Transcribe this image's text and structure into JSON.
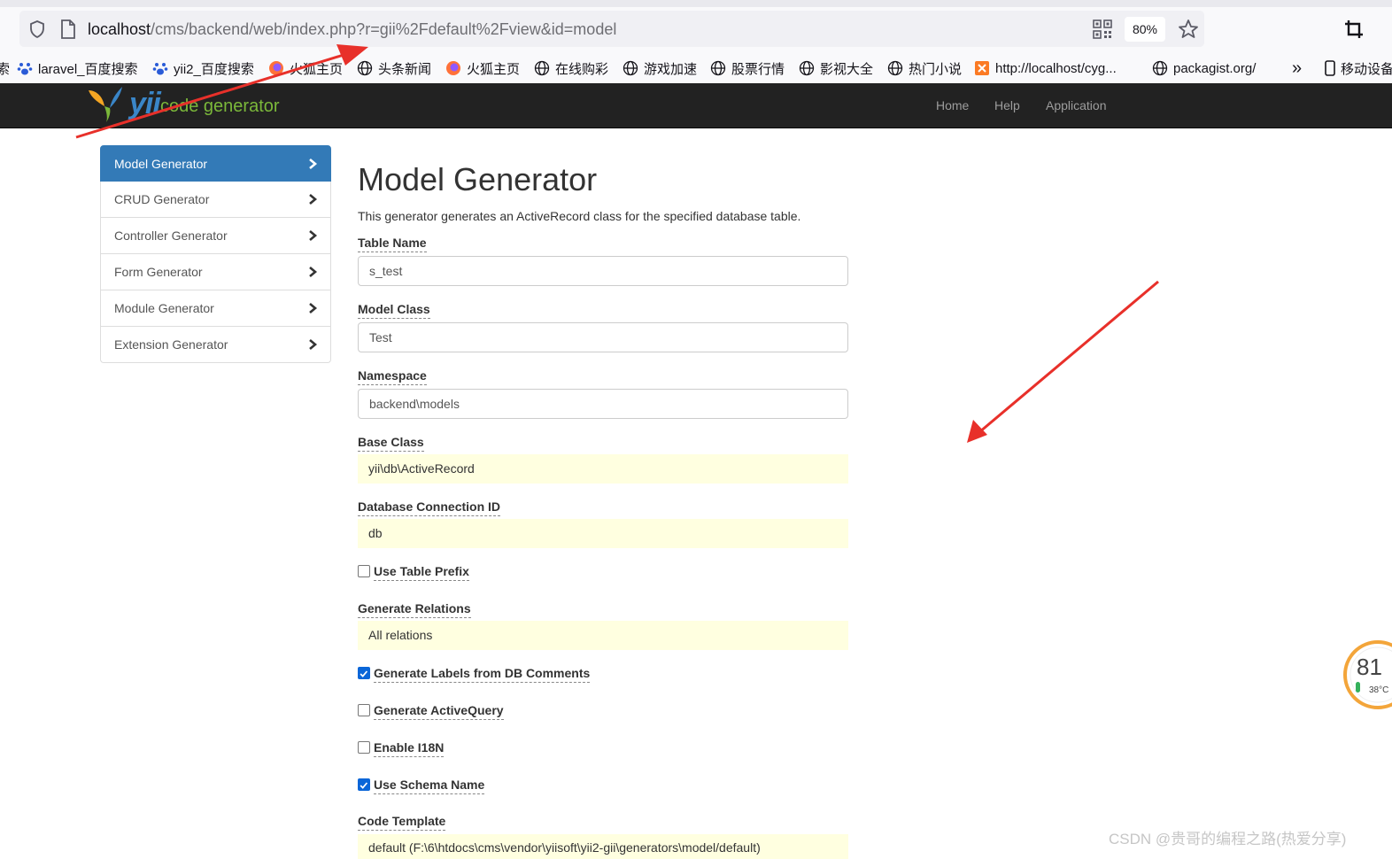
{
  "browser": {
    "url_host": "localhost",
    "url_path": "/cms/backend/web/index.php?r=gii%2Fdefault%2Fview&id=model",
    "zoom": "80%",
    "bookmarks": [
      {
        "label": "laravel_百度搜索",
        "icon": "paw-icon"
      },
      {
        "label": "yii2_百度搜索",
        "icon": "paw-icon"
      },
      {
        "label": "火狐主页",
        "icon": "firefox-icon"
      },
      {
        "label": "头条新闻",
        "icon": "globe-icon"
      },
      {
        "label": "火狐主页",
        "icon": "firefox-icon"
      },
      {
        "label": "在线购彩",
        "icon": "globe-icon"
      },
      {
        "label": "游戏加速",
        "icon": "globe-icon"
      },
      {
        "label": "股票行情",
        "icon": "globe-icon"
      },
      {
        "label": "影视大全",
        "icon": "globe-icon"
      },
      {
        "label": "热门小说",
        "icon": "globe-icon"
      },
      {
        "label": "http://localhost/cyg...",
        "icon": "xampp-icon"
      },
      {
        "label": "packagist.org/",
        "icon": "globe-icon"
      }
    ],
    "more": "»",
    "mobile_bookmarks": "移动设备"
  },
  "navbar": {
    "brand_yii": "yii",
    "brand_rest": "code generator",
    "links": [
      "Home",
      "Help",
      "Application"
    ]
  },
  "sidebar": {
    "items": [
      {
        "label": "Model Generator",
        "active": true
      },
      {
        "label": "CRUD Generator"
      },
      {
        "label": "Controller Generator"
      },
      {
        "label": "Form Generator"
      },
      {
        "label": "Module Generator"
      },
      {
        "label": "Extension Generator"
      }
    ]
  },
  "main": {
    "title": "Model Generator",
    "description": "This generator generates an ActiveRecord class for the specified database table.",
    "table_name": {
      "label": "Table Name",
      "value": "s_test"
    },
    "model_class": {
      "label": "Model Class",
      "value": "Test"
    },
    "namespace": {
      "label": "Namespace",
      "value": "backend\\models"
    },
    "base_class": {
      "label": "Base Class",
      "value": "yii\\db\\ActiveRecord"
    },
    "db_connection": {
      "label": "Database Connection ID",
      "value": "db"
    },
    "use_table_prefix": {
      "label": "Use Table Prefix",
      "checked": false
    },
    "generate_relations": {
      "label": "Generate Relations",
      "value": "All relations"
    },
    "generate_labels": {
      "label": "Generate Labels from DB Comments",
      "checked": true
    },
    "generate_activequery": {
      "label": "Generate ActiveQuery",
      "checked": false
    },
    "enable_i18n": {
      "label": "Enable I18N",
      "checked": false
    },
    "use_schema_name": {
      "label": "Use Schema Name",
      "checked": true
    },
    "code_template": {
      "label": "Code Template",
      "value": "default (F:\\6\\htdocs\\cms\\vendor\\yiisoft\\yii2-gii\\generators\\model/default)"
    }
  },
  "widget": {
    "value": "81",
    "temp": "38°C"
  },
  "watermark": "CSDN @贵哥的编程之路(热爱分享)",
  "colors": {
    "accent": "#337ab7",
    "navbar": "#222222",
    "sticky": "#ffffe0",
    "arrow": "#e8302a"
  }
}
